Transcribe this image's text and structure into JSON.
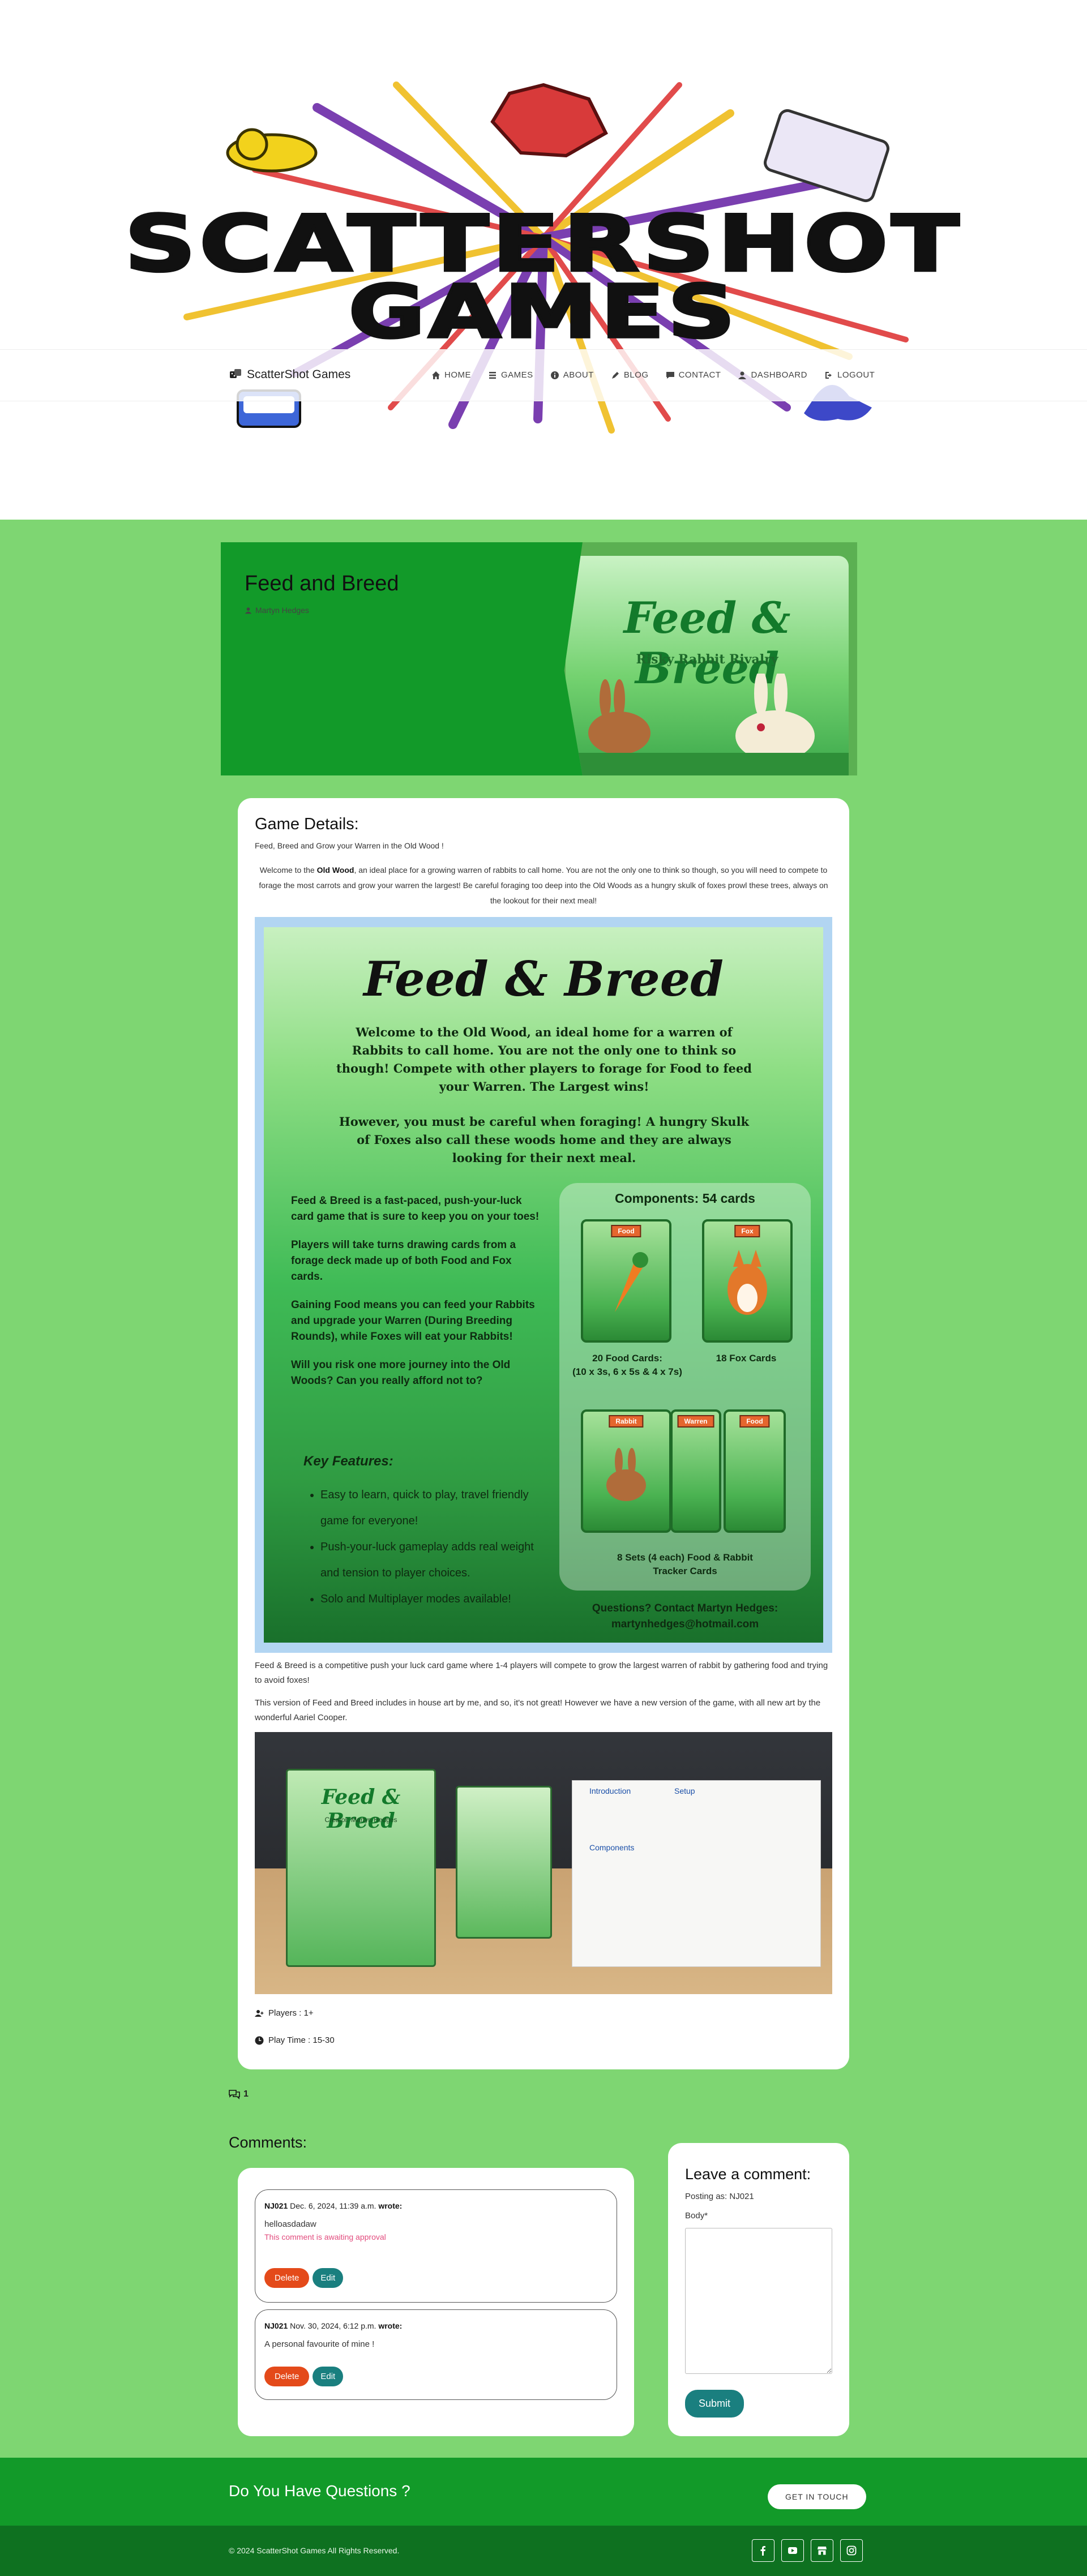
{
  "logo": {
    "line1": "SCATTERSHOT",
    "line2": "GAMES"
  },
  "nav": {
    "brand": "ScatterShot Games",
    "links": [
      {
        "label": "HOME",
        "icon": "home-icon"
      },
      {
        "label": "GAMES",
        "icon": "list-icon"
      },
      {
        "label": "ABOUT",
        "icon": "info-icon"
      },
      {
        "label": "BLOG",
        "icon": "blog-icon"
      },
      {
        "label": "CONTACT",
        "icon": "chat-icon"
      },
      {
        "label": "DASHBOARD",
        "icon": "user-icon"
      },
      {
        "label": "LOGOUT",
        "icon": "logout-icon"
      }
    ]
  },
  "game": {
    "title": "Feed and Breed",
    "author": "Martyn Hedges",
    "cover_title": "Feed & Breed",
    "cover_subtitle": "Risky Rabbit Rivalry"
  },
  "details": {
    "heading": "Game Details:",
    "tagline": "Feed, Breed and Grow your Warren in the Old Wood !",
    "intro_before": "Welcome to the ",
    "intro_bold": "Old Wood",
    "intro_after": ", an ideal place for a growing warren of rabbits to call home. You are not the only one to think so though, so you will need to compete to forage the most carrots and grow your warren the largest! Be careful foraging too deep into the Old Woods as a hungry skulk of foxes prowl these trees, always on the lookout for their next meal!",
    "poster": {
      "title": "Feed & Breed",
      "welcome": "Welcome to the Old Wood, an ideal home for a warren of Rabbits to call home. You are not the only one to think so though! Compete with other players to forage for Food to feed your Warren. The Largest wins!",
      "warning": "However, you must be careful when foraging! A hungry Skulk of Foxes also call these woods home and they are always looking for their next meal.",
      "left_paras": [
        "Feed & Breed is a fast-paced, push-your-luck card game that is sure to keep you on your toes!",
        "Players will take turns drawing cards from a forage deck made up of both Food and Fox cards.",
        "Gaining Food means you can feed your Rabbits and upgrade your Warren (During Breeding Rounds), while Foxes will eat your Rabbits!",
        "Will you risk one more journey into the Old Woods? Can you really afford not to?"
      ],
      "features_heading": "Key Features:",
      "features": [
        "Easy to learn, quick to play, travel friendly game for everyone!",
        "Push-your-luck gameplay adds real weight and tension to player choices.",
        "Solo and Multiplayer modes available!"
      ],
      "components_heading": "Components: 54 cards",
      "food_label": "Food",
      "fox_label": "Fox",
      "rabbit_label": "Rabbit",
      "warren_label": "Warren",
      "food_caption": "20 Food Cards:\n(10 x 3s, 6 x 5s & 4 x 7s)",
      "fox_caption": "18 Fox Cards",
      "tracker_caption": "8 Sets (4 each) Food & Rabbit Tracker Cards",
      "contact": "Questions? Contact Martyn Hedges: martynhedges@hotmail.com"
    },
    "para1": "Feed & Breed is a competitive push your luck card game where 1-4 players will compete to grow the largest warren of rabbit by gathering food and trying to avoid foxes!",
    "para2": "This version of Feed and Breed includes in house art by me, and so, it's not great! However we have a new version of the game, with all new art by the wonderful Aariel Cooper.",
    "photo": {
      "box_title": "Feed & Breed",
      "box_creator": "Creator: Martyn Hedges",
      "rules_intro": "Introduction",
      "rules_setup": "Setup",
      "rules_components": "Components"
    },
    "players": "Players : 1+",
    "play_time": "Play Time : 15-30"
  },
  "comments": {
    "count": "1",
    "heading": "Comments:",
    "items": [
      {
        "user": "NJ021",
        "date": "Dec. 6, 2024, 11:39 a.m.",
        "wrote": "wrote:",
        "body": "helloasdadaw",
        "pending": "This comment is awaiting approval"
      },
      {
        "user": "NJ021",
        "date": "Nov. 30, 2024, 6:12 p.m.",
        "wrote": "wrote:",
        "body": "A personal favourite of mine !"
      }
    ],
    "delete_label": "Delete",
    "edit_label": "Edit"
  },
  "leave_comment": {
    "heading": "Leave a comment:",
    "posting_as": "Posting as: NJ021",
    "body_label": "Body*",
    "submit_label": "Submit"
  },
  "footer": {
    "cta_text": "Do You Have Questions ?",
    "cta_button": "GET IN TOUCH",
    "copyright": "© 2024 ScatterShot Games All Rights Reserved.",
    "socials": [
      "facebook-icon",
      "youtube-icon",
      "store-icon",
      "instagram-icon"
    ]
  },
  "colors": {
    "page_green": "#7ed672",
    "header_green": "#129a29",
    "footer_green": "#0e7120",
    "teal_button": "#1a7f7f",
    "red_button": "#e44a1a"
  }
}
